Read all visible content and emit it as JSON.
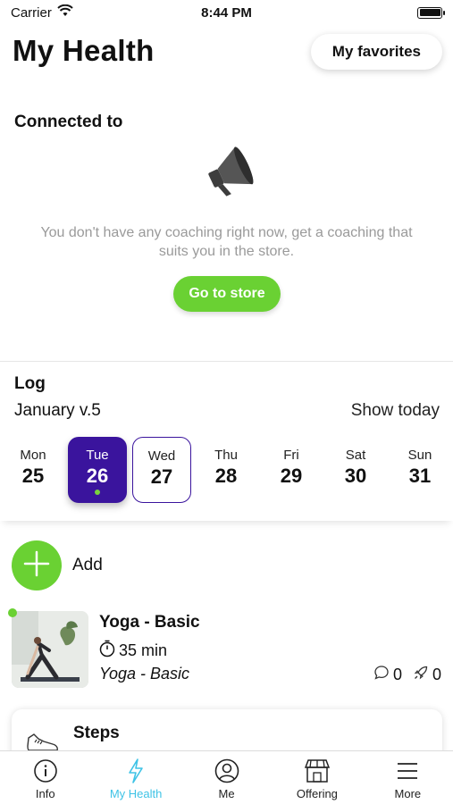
{
  "status_bar": {
    "carrier": "Carrier",
    "time": "8:44 PM"
  },
  "header": {
    "title": "My Health",
    "favorites_label": "My favorites"
  },
  "connected": {
    "title": "Connected to",
    "empty_message": "You don't have any coaching right now, get a coaching that suits you in the store.",
    "store_button": "Go to store"
  },
  "log": {
    "title": "Log",
    "week": "January v.5",
    "show_today": "Show today",
    "days": [
      {
        "name": "Mon",
        "num": "25"
      },
      {
        "name": "Tue",
        "num": "26"
      },
      {
        "name": "Wed",
        "num": "27"
      },
      {
        "name": "Thu",
        "num": "28"
      },
      {
        "name": "Fri",
        "num": "29"
      },
      {
        "name": "Sat",
        "num": "30"
      },
      {
        "name": "Sun",
        "num": "31"
      }
    ],
    "selected_index": 1,
    "today_index": 2
  },
  "add": {
    "label": "Add"
  },
  "activity": {
    "title": "Yoga - Basic",
    "duration": "35 min",
    "subtitle": "Yoga - Basic",
    "comments": "0",
    "kudos": "0"
  },
  "steps": {
    "title": "Steps"
  },
  "tabs": [
    {
      "label": "Info",
      "icon": "info-icon"
    },
    {
      "label": "My Health",
      "icon": "lightning-icon"
    },
    {
      "label": "Me",
      "icon": "person-icon"
    },
    {
      "label": "Offering",
      "icon": "store-icon"
    },
    {
      "label": "More",
      "icon": "menu-icon"
    }
  ],
  "colors": {
    "accent_green": "#6ad133",
    "selected_purple": "#3a149d",
    "tab_active": "#3fc3e6"
  }
}
